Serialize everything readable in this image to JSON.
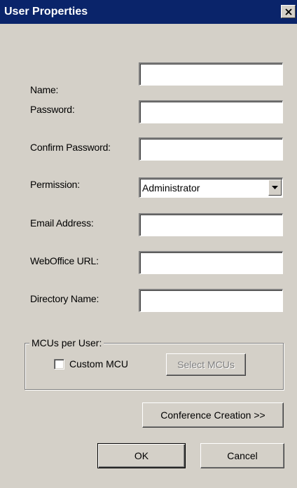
{
  "window": {
    "title": "User Properties",
    "close_glyph": "close-icon"
  },
  "form": {
    "name": {
      "label": "Name:",
      "value": ""
    },
    "password": {
      "label": "Password:",
      "value": ""
    },
    "confirm_password": {
      "label": "Confirm Password:",
      "value": ""
    },
    "permission": {
      "label": "Permission:",
      "selected": "Administrator"
    },
    "email": {
      "label": "Email Address:",
      "value": ""
    },
    "weboffice_url": {
      "label": "WebOffice URL:",
      "value": ""
    },
    "directory_name": {
      "label": "Directory Name:",
      "value": ""
    }
  },
  "mcus_group": {
    "legend": "MCUs per User:",
    "custom_mcu_label": "Custom MCU",
    "custom_mcu_checked": false,
    "select_mcus_label": "Select MCUs"
  },
  "buttons": {
    "conference_creation": "Conference Creation >>",
    "ok": "OK",
    "cancel": "Cancel"
  },
  "colors": {
    "titlebar": "#0a246a",
    "dialog_face": "#d4d0c8"
  }
}
